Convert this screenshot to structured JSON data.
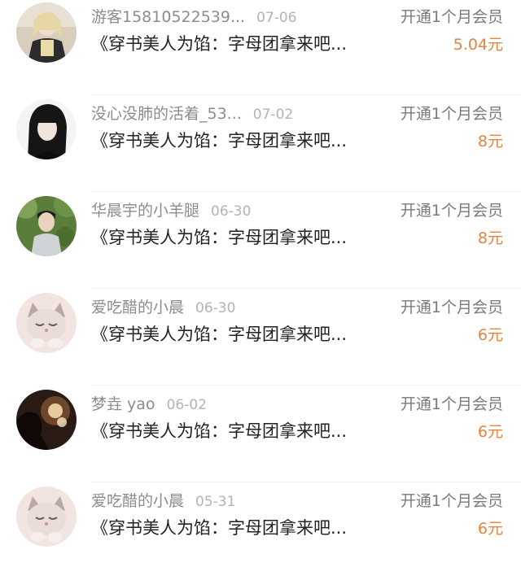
{
  "records": [
    {
      "name": "游客15810522539...",
      "date": "07-06",
      "title": "《穿书美人为馅：字母团拿来吧...",
      "desc": "开通1个月会员",
      "amount": "5.04元",
      "avatar": "blonde-woman-avatar"
    },
    {
      "name": "没心没肺的活着_53...",
      "date": "07-02",
      "title": "《穿书美人为馅：字母团拿来吧...",
      "desc": "开通1个月会员",
      "amount": "8元",
      "avatar": "dark-hair-girl-avatar"
    },
    {
      "name": "华晨宇的小羊腿",
      "date": "06-30",
      "title": "《穿书美人为馅：字母团拿来吧...",
      "desc": "开通1个月会员",
      "amount": "8元",
      "avatar": "person-in-forest-avatar"
    },
    {
      "name": "爱吃醋的小晨",
      "date": "06-30",
      "title": "《穿书美人为馅：字母团拿来吧...",
      "desc": "开通1个月会员",
      "amount": "6元",
      "avatar": "sleepy-kitten-avatar"
    },
    {
      "name": "梦垚 yao",
      "date": "06-02",
      "title": "《穿书美人为馅：字母团拿来吧...",
      "desc": "开通1个月会员",
      "amount": "6元",
      "avatar": "silhouette-sparkler-avatar"
    },
    {
      "name": "爱吃醋的小晨",
      "date": "05-31",
      "title": "《穿书美人为馅：字母团拿来吧...",
      "desc": "开通1个月会员",
      "amount": "6元",
      "avatar": "sleepy-kitten-avatar"
    }
  ],
  "colors": {
    "amount": "#e4843f",
    "name": "#8c8c8c",
    "date": "#b3b3b3",
    "title": "#222222",
    "desc": "#7a7a7a"
  }
}
